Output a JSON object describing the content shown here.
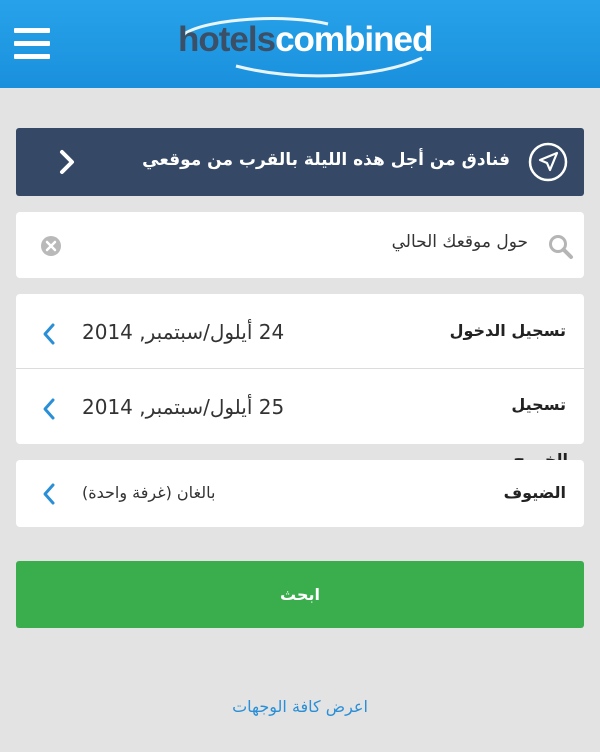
{
  "header": {
    "logo_part1": "hotels",
    "logo_part2": "combined"
  },
  "nearby": {
    "label": "فنادق من أجل هذه الليلة بالقرب من موقعي"
  },
  "search": {
    "value": "حول موقعك الحالي"
  },
  "checkin": {
    "label": "تسجيل الدخول",
    "value": "24 أيلول/سبتمبر, 2014"
  },
  "checkout": {
    "label_line1": "تسجيل",
    "label_line2": "الخروج",
    "value": "25 أيلول/سبتمبر, 2014"
  },
  "guests": {
    "label": "الضيوف",
    "value": "بالغان (غرفة واحدة)"
  },
  "search_button": {
    "label": "ابحث"
  },
  "footer": {
    "all_destinations": "اعرض كافة الوجهات"
  },
  "colors": {
    "topbar": "#1e98e2",
    "nearby_bg": "#354966",
    "search_btn": "#3aad4c",
    "link": "#2a8fd6",
    "chevron": "#2a8fd6"
  }
}
